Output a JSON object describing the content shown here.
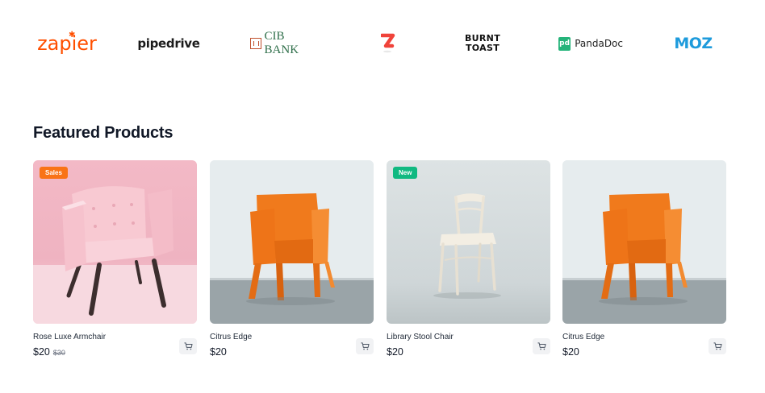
{
  "brand_logos": [
    {
      "name": "zapier",
      "text": "zapier",
      "color": "#ff4f00"
    },
    {
      "name": "pipedrive",
      "text": "pipedrive",
      "color": "#1a1a1a"
    },
    {
      "name": "cib-bank",
      "text": "CIB BANK",
      "color": "#2f6f4a"
    },
    {
      "name": "zeplin-z",
      "text": "",
      "color": "#f0433a"
    },
    {
      "name": "burnt-toast",
      "line1": "BURNT",
      "line2": "TOAST",
      "color": "#111111"
    },
    {
      "name": "pandadoc",
      "mark": "pd",
      "text": "PandaDoc",
      "color": "#25b47a"
    },
    {
      "name": "moz",
      "text": "MOZ",
      "color": "#1e9bdc"
    }
  ],
  "logos": {
    "zapier": "zapier",
    "pipedrive": "pipedrive",
    "cib": "CIB BANK",
    "burnt_line1": "BURNT",
    "burnt_line2": "TOAST",
    "panda_mark": "pd",
    "panda": "PandaDoc",
    "moz": "MOZ"
  },
  "section": {
    "title": "Featured Products"
  },
  "products": [
    {
      "name": "Rose Luxe Armchair",
      "price": "$20",
      "old_price": "$30",
      "badge": "Sales",
      "image": "pink-armchair"
    },
    {
      "name": "Citrus Edge",
      "price": "$20",
      "old_price": "",
      "badge": "",
      "image": "orange-chair"
    },
    {
      "name": "Library Stool Chair",
      "price": "$20",
      "old_price": "",
      "badge": "New",
      "image": "white-wooden-chair"
    },
    {
      "name": "Citrus Edge",
      "price": "$20",
      "old_price": "",
      "badge": "",
      "image": "orange-chair"
    }
  ],
  "colors": {
    "badge_sales": "#f97316",
    "badge_new": "#10b981",
    "cart_bg": "#f1f2f4"
  },
  "icons": {
    "cart": "cart-icon"
  }
}
